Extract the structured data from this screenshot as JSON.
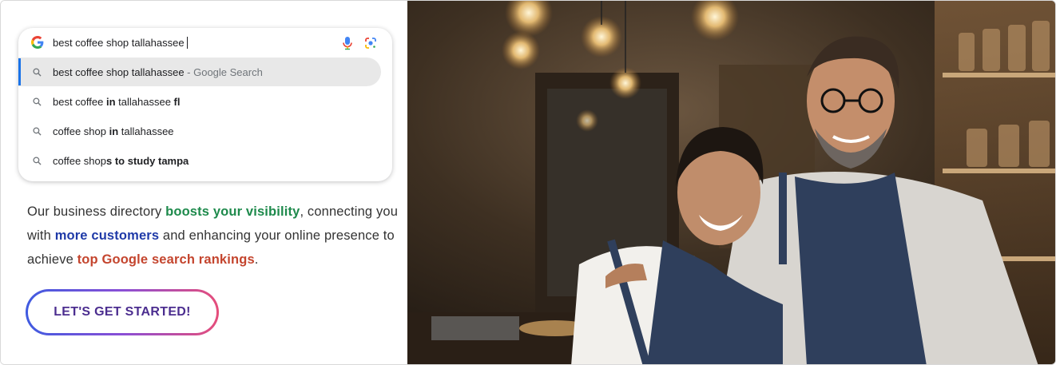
{
  "search": {
    "query": "best coffee shop tallahassee",
    "suggestions": [
      {
        "normal": "best coffee shop tallahassee",
        "bold": "",
        "suffix": " - Google Search"
      },
      {
        "normal": "best coffee ",
        "bold": "in",
        "rest_normal": " tallahassee ",
        "rest_bold": "fl"
      },
      {
        "normal": "coffee shop ",
        "bold": "in",
        "rest_normal": " tallahassee",
        "rest_bold": ""
      },
      {
        "normal": "coffee shop",
        "bold": "s to study tampa",
        "rest_normal": "",
        "rest_bold": ""
      }
    ]
  },
  "paragraph": {
    "p1": "Our business directory ",
    "h1": "boosts your visibility",
    "p2": ", connecting you with ",
    "h2": "more customers",
    "p3": " and enhancing your online presence to achieve ",
    "h3": "top Google search rankings",
    "p4": "."
  },
  "cta": {
    "label": "LET'S GET STARTED!"
  },
  "colors": {
    "accent_blue": "#1a73e8",
    "highlight_green": "#1e8a4c",
    "highlight_blue": "#1f3aa8",
    "highlight_red": "#c4452e",
    "cta_text": "#4b2d8f"
  },
  "photo": {
    "description_icon": "coffee-shop-owners-photo"
  }
}
